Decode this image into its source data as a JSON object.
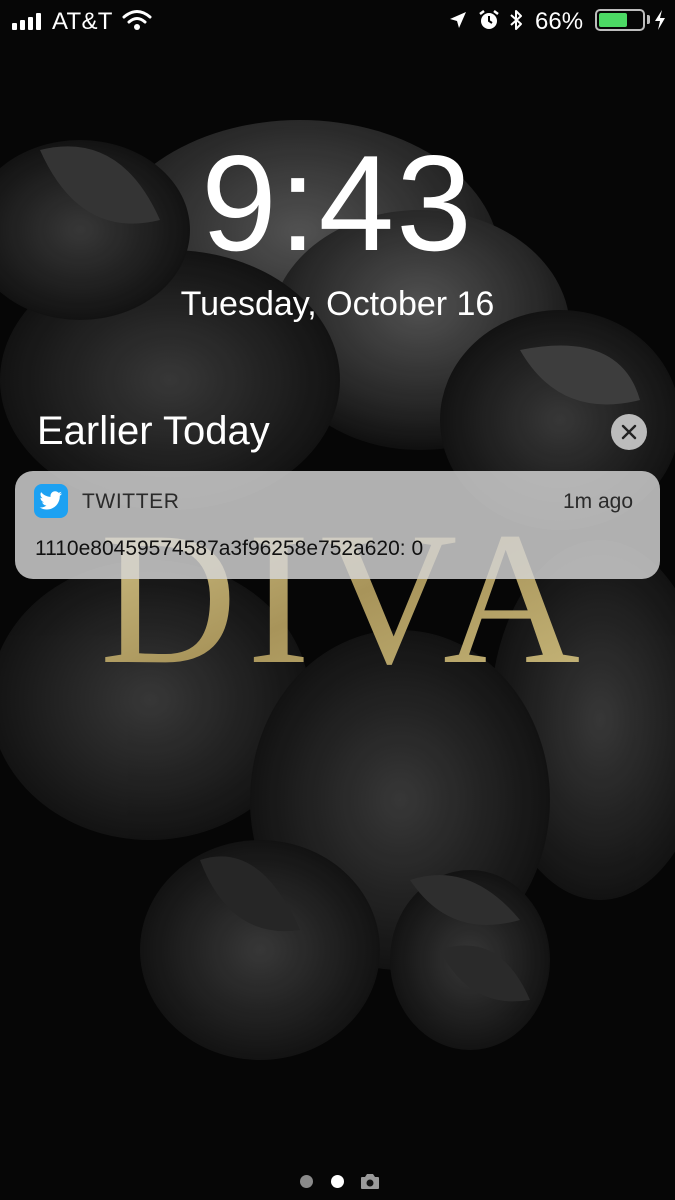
{
  "status_bar": {
    "carrier": "AT&T",
    "battery_percent": "66%",
    "battery_level": 0.66,
    "battery_color": "#4cd964",
    "icons": [
      "signal-icon",
      "wifi-icon",
      "location-icon",
      "alarm-icon",
      "bluetooth-icon",
      "battery-icon",
      "charging-icon"
    ]
  },
  "lock_screen": {
    "time": "9:43",
    "date": "Tuesday, October 16"
  },
  "notifications": {
    "section_title": "Earlier Today",
    "clear_icon": "close-icon",
    "items": [
      {
        "app": "TWITTER",
        "app_icon": "twitter-bird-icon",
        "app_color": "#1da1f2",
        "time_ago": "1m ago",
        "message": "1110e80459574587a3f96258e752a620: 0"
      }
    ]
  },
  "wallpaper": {
    "text": "DIVA",
    "text_color": "#b9a76b"
  },
  "page_indicator": {
    "pages": 2,
    "current": 2,
    "camera_icon": "camera-icon"
  }
}
